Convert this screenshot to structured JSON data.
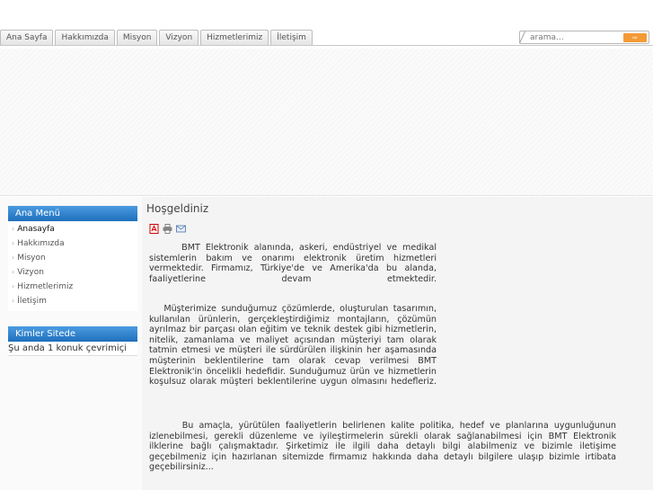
{
  "nav": {
    "tabs": [
      {
        "label": "Ana Sayfa"
      },
      {
        "label": "Hakkımızda"
      },
      {
        "label": "Misyon"
      },
      {
        "label": "Vizyon"
      },
      {
        "label": "Hizmetlerimiz"
      },
      {
        "label": "İletişim"
      }
    ]
  },
  "search": {
    "placeholder": "arama...",
    "button_label": "⇨"
  },
  "sidebar": {
    "menu_title": "Ana Menü",
    "items": [
      {
        "label": "Anasayfa",
        "active": true
      },
      {
        "label": "Hakkımızda"
      },
      {
        "label": "Misyon"
      },
      {
        "label": "Vizyon"
      },
      {
        "label": "Hizmetlerimiz"
      },
      {
        "label": "İletişim"
      }
    ],
    "online_title": "Kimler Sitede",
    "online_text": "Şu anda 1 konuk çevrimiçi"
  },
  "article": {
    "title": "Hoşgeldiniz",
    "icons": [
      "pdf-icon",
      "print-icon",
      "email-icon"
    ],
    "paragraphs": [
      "      BMT Elektronik alanında, askeri, endüstriyel ve medikal sistemlerin bakım ve onarımı elektronik üretim hizmetleri vermektedir. Firmamız, Türkiye'de ve Amerika'da bu alanda, faaliyetlerine devam etmektedir.",
      "   Müşterimize sunduğumuz çözümlerde, oluşturulan tasarımın, kullanılan ürünlerin, gerçekleştirdiğimiz montajların, çözümün ayrılmaz bir parçası olan eğitim ve teknik destek gibi hizmetlerin, nitelik, zamanlama ve maliyet açısından müşteriyi tam olarak tatmin etmesi ve müşteri ile sürdürülen ilişkinin her aşamasında müşterinin beklentilerine tam olarak cevap verilmesi BMT Elektronik'in öncelikli hedefidir. Sunduğumuz ürün ve hizmetlerin koşulsuz olarak müşteri beklentilerine uygun olmasını hedefleriz.",
      "      Bu amaçla, yürütülen faaliyetlerin belirlenen kalite politika, hedef ve planlarına uygunluğunun izlenebilmesi, gerekli düzenleme ve iyileştirmelerin sürekli olarak sağlanabilmesi için BMT Elektronik ilklerine bağlı çalışmaktadır. Şirketimiz ile ilgili daha detaylı bilgi alabilmeniz ve bizimle iletişime geçebilmeniz için hazırlanan sitemizde firmamız hakkında daha detaylı bilgilere ulaşıp bizimle irtibata geçebilirsiniz..."
    ]
  },
  "colors": {
    "module_header": "#2b7fcf",
    "search_button": "#f39a37"
  }
}
